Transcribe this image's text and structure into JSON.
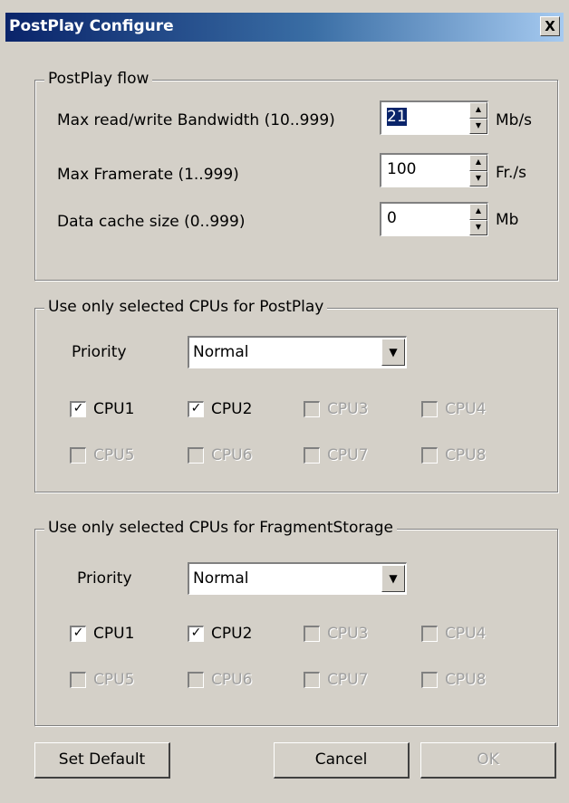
{
  "window": {
    "title": "PostPlay Configure",
    "close_glyph": "X"
  },
  "flow": {
    "legend": "PostPlay flow",
    "rows": [
      {
        "label": "Max read/write Bandwidth (10..999)",
        "value": "21",
        "unit": "Mb/s"
      },
      {
        "label": "Max Framerate (1..999)",
        "value": "100",
        "unit": "Fr./s"
      },
      {
        "label": "Data cache size (0..999)",
        "value": "0",
        "unit": "Mb"
      }
    ]
  },
  "postplay_cpus": {
    "legend": "Use only selected CPUs for PostPlay",
    "priority_label": "Priority",
    "priority_value": "Normal",
    "cpus": [
      {
        "label": "CPU1",
        "checked": true,
        "enabled": true
      },
      {
        "label": "CPU2",
        "checked": true,
        "enabled": true
      },
      {
        "label": "CPU3",
        "checked": false,
        "enabled": false
      },
      {
        "label": "CPU4",
        "checked": false,
        "enabled": false
      },
      {
        "label": "CPU5",
        "checked": false,
        "enabled": false
      },
      {
        "label": "CPU6",
        "checked": false,
        "enabled": false
      },
      {
        "label": "CPU7",
        "checked": false,
        "enabled": false
      },
      {
        "label": "CPU8",
        "checked": false,
        "enabled": false
      }
    ]
  },
  "fragment_cpus": {
    "legend": "Use only selected CPUs for FragmentStorage",
    "priority_label": "Priority",
    "priority_value": "Normal",
    "cpus": [
      {
        "label": "CPU1",
        "checked": true,
        "enabled": true
      },
      {
        "label": "CPU2",
        "checked": true,
        "enabled": true
      },
      {
        "label": "CPU3",
        "checked": false,
        "enabled": false
      },
      {
        "label": "CPU4",
        "checked": false,
        "enabled": false
      },
      {
        "label": "CPU5",
        "checked": false,
        "enabled": false
      },
      {
        "label": "CPU6",
        "checked": false,
        "enabled": false
      },
      {
        "label": "CPU7",
        "checked": false,
        "enabled": false
      },
      {
        "label": "CPU8",
        "checked": false,
        "enabled": false
      }
    ]
  },
  "buttons": {
    "set_default": "Set Default",
    "cancel": "Cancel",
    "ok": "OK"
  }
}
